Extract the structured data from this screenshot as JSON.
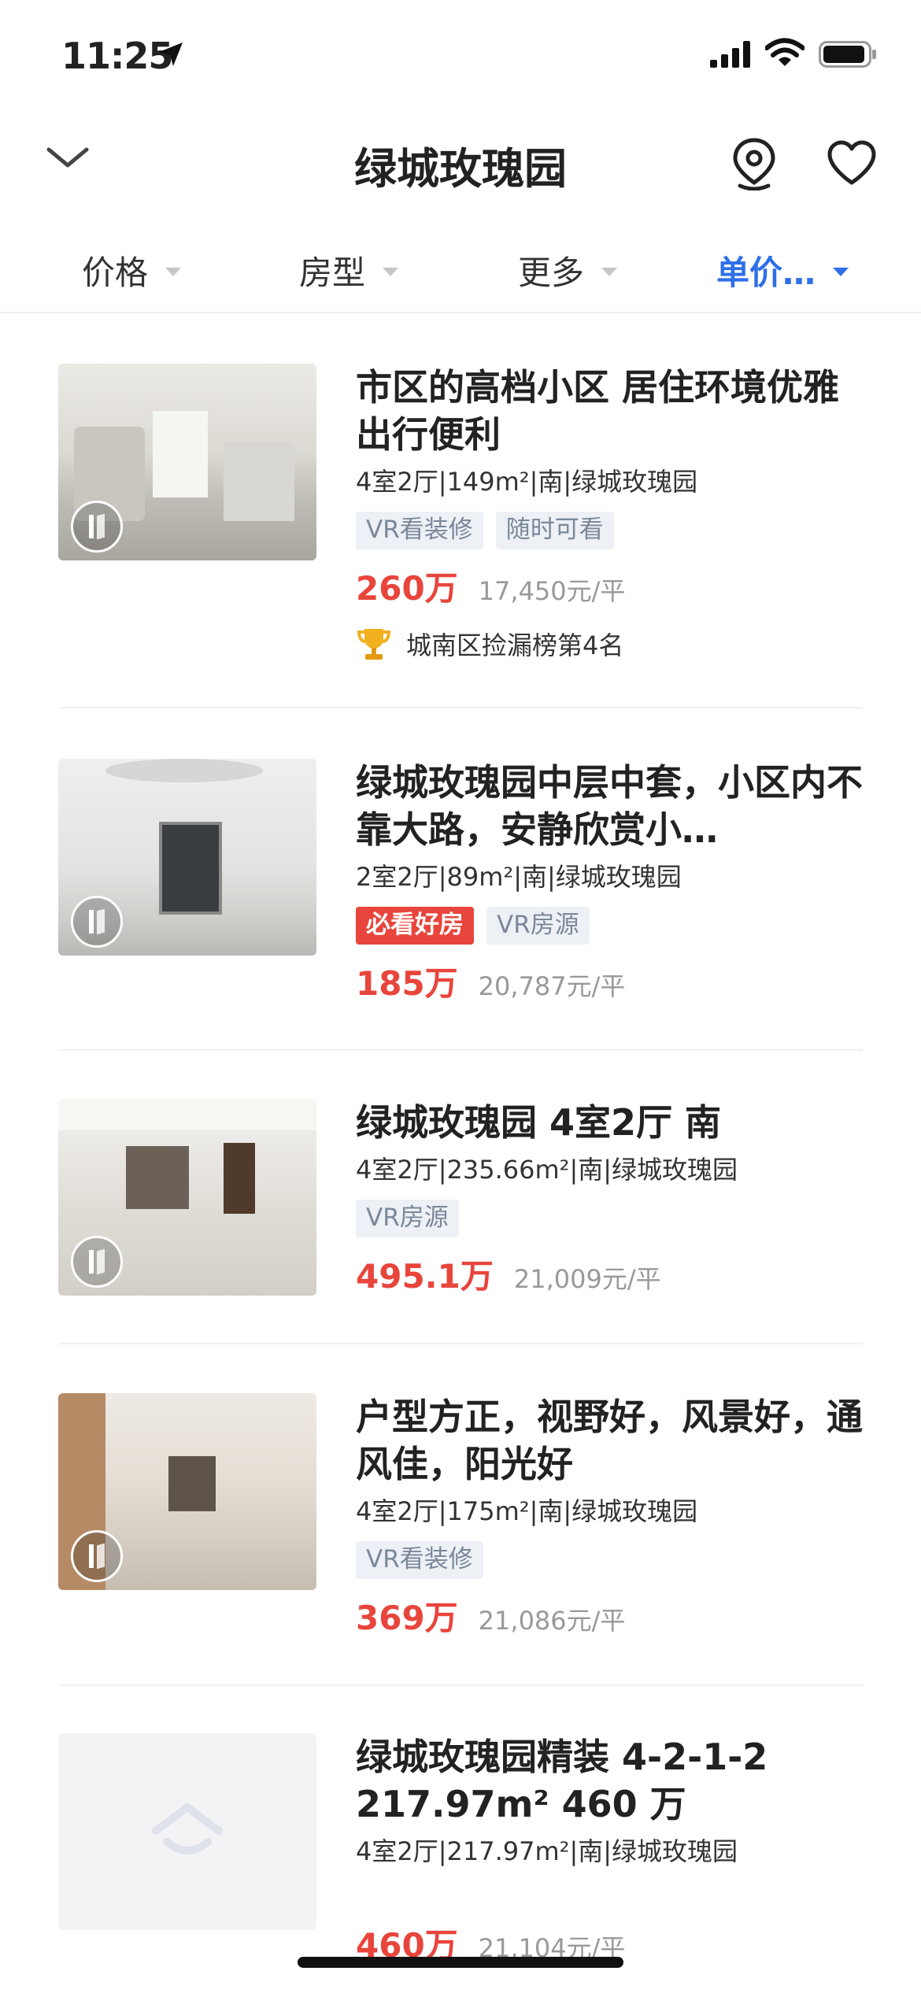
{
  "status": {
    "time": "11:25"
  },
  "nav": {
    "title": "绿城玫瑰园"
  },
  "filters": [
    "价格",
    "房型",
    "更多",
    "单价…"
  ],
  "listings": [
    {
      "title": "市区的高档小区 居住环境优雅出行便利",
      "meta": "4室2厅|149m²|南|绿城玫瑰园",
      "tags": [
        "VR看装修",
        "随时可看"
      ],
      "price": "260万",
      "unit_price": "17,450元/平",
      "rank": "城南区捡漏榜第4名"
    },
    {
      "title": "绿城玫瑰园中层中套，小区内不靠大路，安静欣赏小…",
      "meta": "2室2厅|89m²|南|绿城玫瑰园",
      "tags": [
        "必看好房",
        "VR房源"
      ],
      "price": "185万",
      "unit_price": "20,787元/平"
    },
    {
      "title": "绿城玫瑰园 4室2厅 南",
      "meta": "4室2厅|235.66m²|南|绿城玫瑰园",
      "tags": [
        "VR房源"
      ],
      "price": "495.1万",
      "unit_price": "21,009元/平"
    },
    {
      "title": "户型方正，视野好，风景好，通风佳，阳光好",
      "meta": "4室2厅|175m²|南|绿城玫瑰园",
      "tags": [
        "VR看装修"
      ],
      "price": "369万",
      "unit_price": "21,086元/平"
    },
    {
      "title": "绿城玫瑰园精装 4-2-1-2 217.97m² 460 万",
      "meta": "4室2厅|217.97m²|南|绿城玫瑰园",
      "tags": [],
      "price": "460万",
      "unit_price": "21,104元/平"
    }
  ]
}
